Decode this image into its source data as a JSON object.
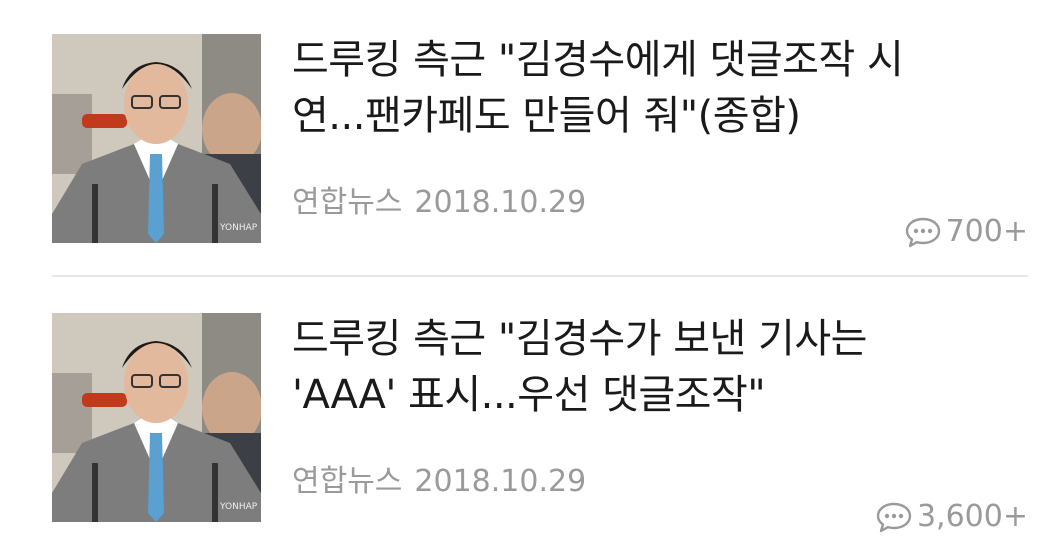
{
  "articles": [
    {
      "headline_line1": "드루킹 측근 \"김경수에게 댓글조작 시",
      "headline_line2": "연...팬카페도 만들어 줘\"(종합)",
      "source": "연합뉴스",
      "date": "2018.10.29",
      "comment_count": "700+",
      "thumbnail_watermark": "YONHAP"
    },
    {
      "headline_line1": "드루킹 측근 \"김경수가 보낸 기사는",
      "headline_line2": "'AAA' 표시...우선 댓글조작\"",
      "source": "연합뉴스",
      "date": "2018.10.29",
      "comment_count": "3,600+",
      "thumbnail_watermark": "YONHAP"
    }
  ],
  "icons": {
    "comment": "speech-bubble-icon"
  },
  "colors": {
    "headline": "#1a1a1a",
    "meta": "#9a9a9a",
    "divider": "#e6e6e6"
  }
}
